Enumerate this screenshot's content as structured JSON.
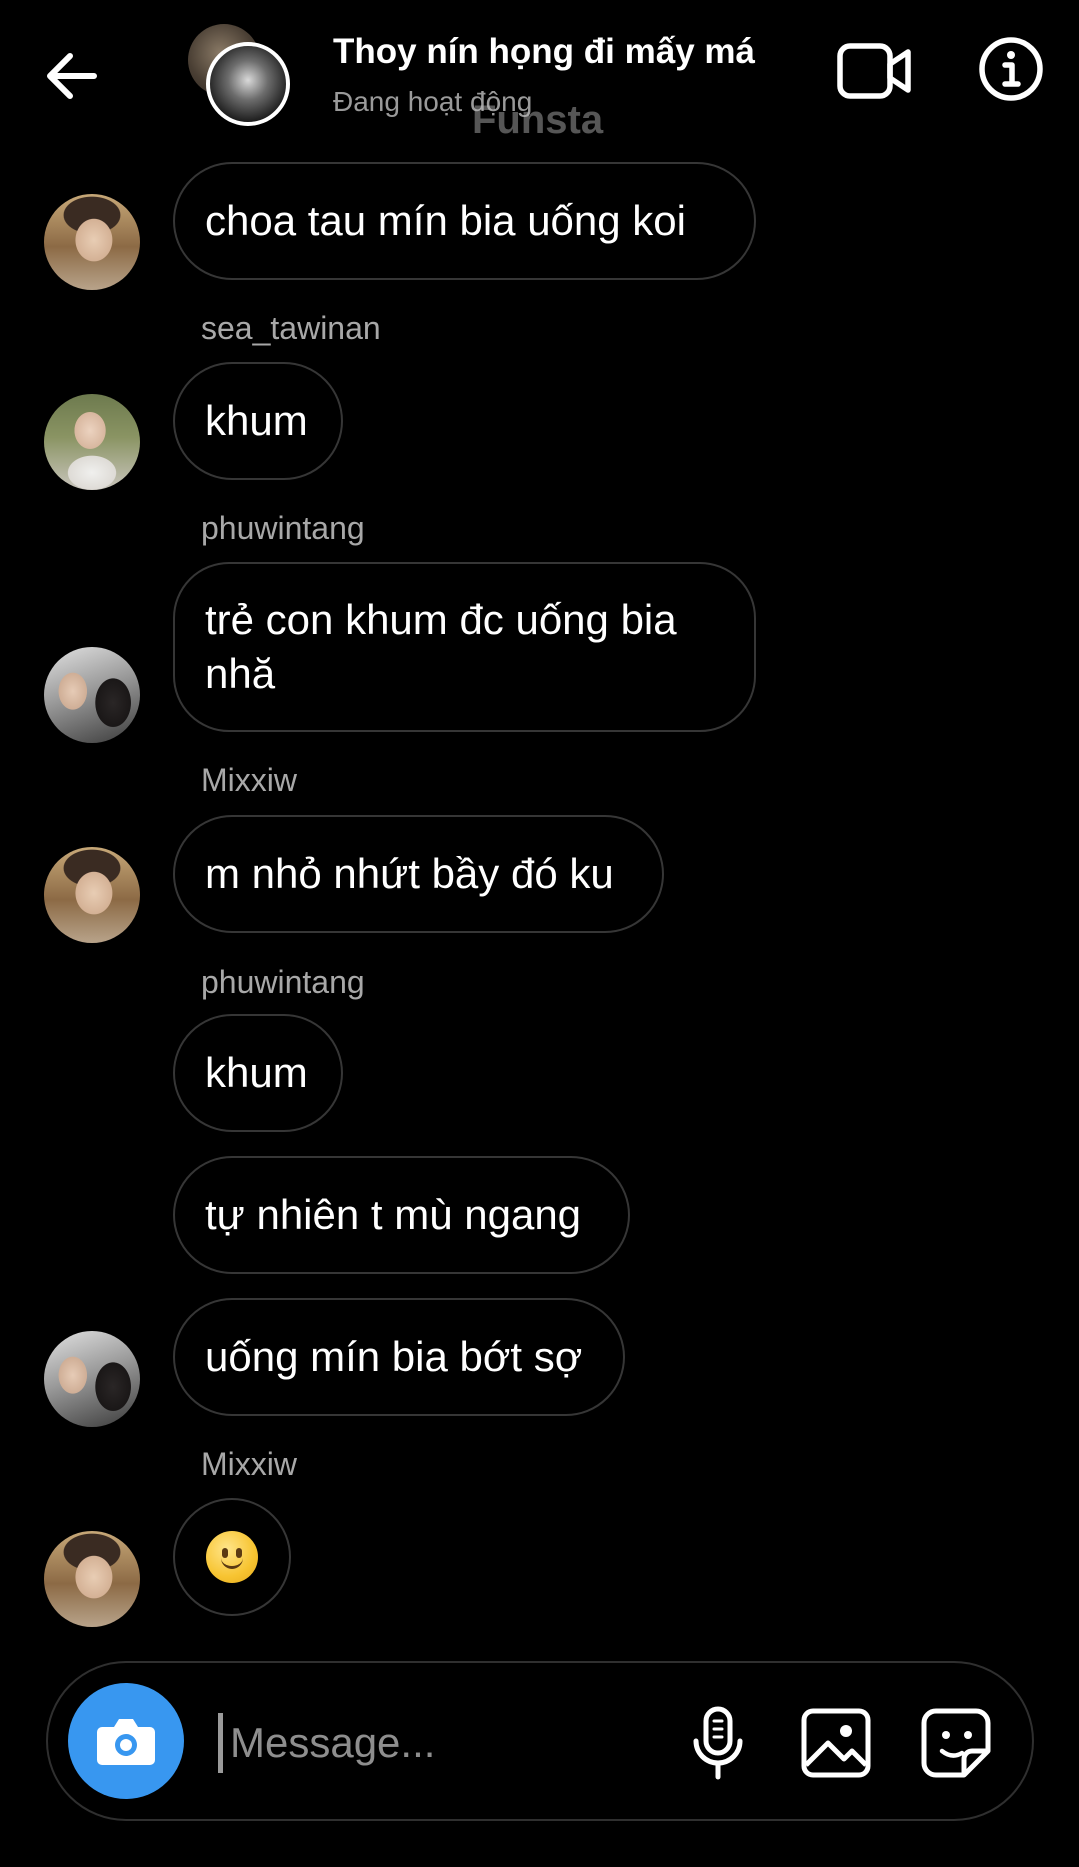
{
  "header": {
    "title": "Thoy nín họng đi mấy má",
    "status": "Đang hoạt động",
    "watermark": "Funsta"
  },
  "icons": {
    "back": "arrow-left-icon",
    "video": "video-camera-icon",
    "info": "info-icon",
    "camera": "camera-icon",
    "mic": "microphone-icon",
    "gallery": "gallery-icon",
    "sticker": "sticker-icon"
  },
  "colors": {
    "background": "#000000",
    "bubble_border": "#363636",
    "sender_text": "#a8a8a8",
    "status_text": "#9a9a9a",
    "camera_button": "#3897f0"
  },
  "messages": [
    {
      "sender": "",
      "text": "choa tau mín bia uống koi"
    },
    {
      "sender": "sea_tawinan",
      "text": "khum"
    },
    {
      "sender": "phuwintang",
      "text": "trẻ con khum đc uống bia nhă"
    },
    {
      "sender": "Mixxiw",
      "text": "m nhỏ nhứt bầy đó ku"
    },
    {
      "sender": "phuwintang",
      "text": "khum"
    },
    {
      "sender": "",
      "text": "tự nhiên t mù ngang"
    },
    {
      "sender": "",
      "text": "uống mín bia bớt sợ"
    },
    {
      "sender": "Mixxiw",
      "text": "🙂",
      "emoji_name": "slightly-smiling-face"
    }
  ],
  "composer": {
    "placeholder": "Message..."
  }
}
